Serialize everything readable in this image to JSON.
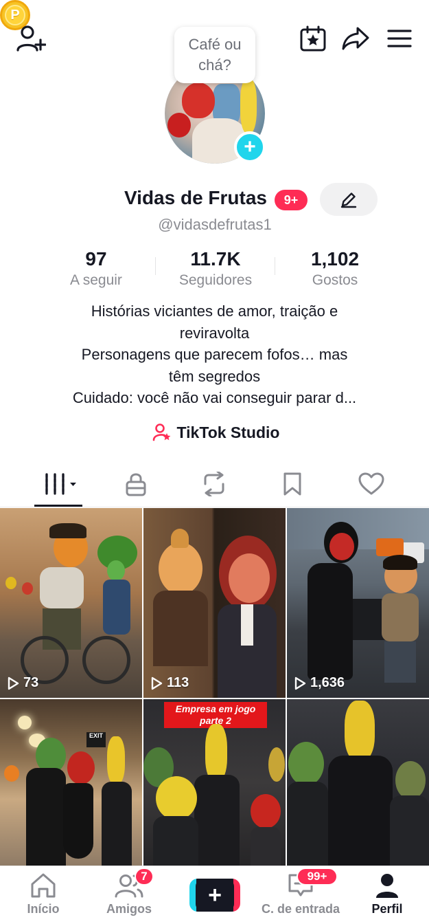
{
  "header": {
    "icons": {
      "add_friend": "person-plus-icon",
      "coin": "coin-icon",
      "coin_letter": "P",
      "calendar": "calendar-star-icon",
      "share": "share-arrow-icon",
      "menu": "hamburger-menu-icon"
    },
    "note_bubble": "Café ou chá?"
  },
  "profile": {
    "display_name": "Vidas de Frutas",
    "name_badge": "9+",
    "username": "@vidasdefrutas1",
    "avatar_add": "+",
    "stats": [
      {
        "value": "97",
        "label": "A seguir"
      },
      {
        "value": "11.7K",
        "label": "Seguidores"
      },
      {
        "value": "1,102",
        "label": "Gostos"
      }
    ],
    "bio": [
      "Histórias viciantes de amor, traição e",
      "reviravolta",
      "Personagens que parecem fofos… mas",
      "têm segredos",
      "Cuidado: você não vai conseguir parar d..."
    ],
    "studio_link": "TikTok Studio"
  },
  "tabs": [
    {
      "name": "videos-grid",
      "icon": "grid-bars-icon",
      "active": true
    },
    {
      "name": "private",
      "icon": "lock-icon"
    },
    {
      "name": "reposts",
      "icon": "repost-icon"
    },
    {
      "name": "favorites",
      "icon": "bookmark-icon"
    },
    {
      "name": "liked",
      "icon": "heart-icon"
    }
  ],
  "videos": [
    {
      "views": "73"
    },
    {
      "views": "113"
    },
    {
      "views": "1,636"
    },
    {
      "views": ""
    },
    {
      "views": "",
      "banner": "Empresa em jogo parte 2"
    },
    {
      "views": ""
    }
  ],
  "colors": {
    "accent_red": "#fe2c55",
    "accent_cyan": "#20d5ec",
    "text_primary": "#161823",
    "text_secondary": "#8a8b91"
  },
  "bottom_nav": {
    "home": "Início",
    "friends": "Amigos",
    "friends_badge": "7",
    "create": "+",
    "inbox": "C. de entrada",
    "inbox_badge": "99+",
    "profile": "Perfil"
  }
}
